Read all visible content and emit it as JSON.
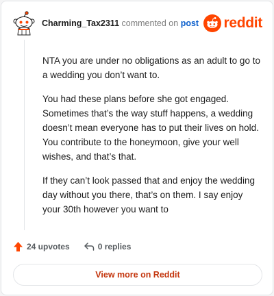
{
  "header": {
    "author": "Charming_Tax2311",
    "commented_on": "commented on",
    "post_link": "post",
    "brand": "reddit",
    "brand_color": "#ff4500",
    "avatar_icon": "snoo-avatar-icon",
    "logo_icon": "reddit-logo-icon"
  },
  "comment": {
    "paragraphs": [
      "NTA you are under no obligations as an adult to go to a wedding you don’t want to.",
      "You had these plans before she got engaged. Sometimes that’s the way stuff happens, a wedding doesn’t mean everyone has to put their lives on hold. You contribute to the honeymoon, give your well wishes, and that’s that.",
      "If they can’t look passed that and enjoy the wedding day without you there, that’s on them. I say enjoy your 30th however you want to"
    ]
  },
  "actions": {
    "upvotes": "24 upvotes",
    "replies": "0 replies",
    "upvote_icon": "upvote-arrow-icon",
    "reply_icon": "reply-arrow-icon"
  },
  "footer": {
    "view_more": "View more on Reddit"
  }
}
